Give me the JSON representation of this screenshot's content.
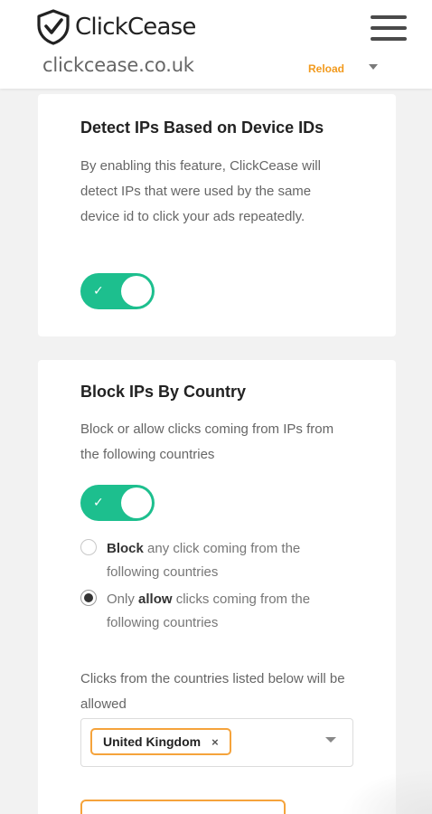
{
  "header": {
    "brand": "ClickCease",
    "domain": "clickcease.co.uk",
    "reload_label": "Reload",
    "logo_icon": "shield-check-icon",
    "menu_icon": "hamburger-menu-icon",
    "dropdown_icon": "caret-down-icon"
  },
  "device_card": {
    "title": "Detect IPs Based on Device IDs",
    "description": "By enabling this feature, ClickCease will detect IPs that were used by the same device id to click your ads repeatedly.",
    "toggle_on": true
  },
  "country_card": {
    "title": "Block IPs By Country",
    "description": "Block or allow clicks coming from IPs from the following countries",
    "toggle_on": true,
    "radio_block": {
      "bold": "Block",
      "rest": " any click coming from the following countries",
      "checked": false
    },
    "radio_allow": {
      "prefix": "Only ",
      "bold": "allow",
      "rest": " clicks coming from the following countries",
      "checked": true
    },
    "list_note": "Clicks from the countries listed below will be allowed",
    "selected_countries": [
      "United Kingdom"
    ],
    "chip_remove": "×"
  },
  "colors": {
    "toggle_on": "#1dbf8e",
    "accent_orange": "#f5a33b",
    "reload_orange": "#f29a1d",
    "background": "#f2f2f2"
  }
}
